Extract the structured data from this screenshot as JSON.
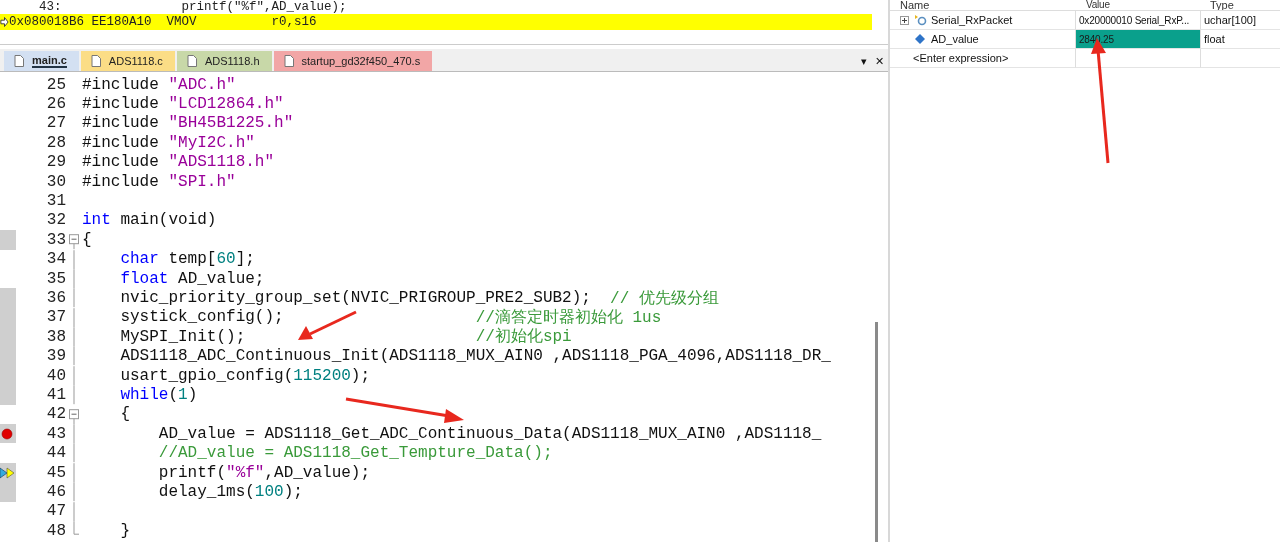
{
  "disassembly": {
    "lines": [
      {
        "text": "    43:                printf(\"%f\",AD_value);",
        "current": false
      },
      {
        "text": "0x080018B6 EE180A10  VMOV          r0,s16",
        "current": true
      }
    ]
  },
  "tabs": [
    {
      "label": "main.c",
      "selected": true,
      "color": "#d3e0f2"
    },
    {
      "label": "ADS1118.c",
      "selected": false,
      "color": "#fbdd86"
    },
    {
      "label": "ADS1118.h",
      "selected": false,
      "color": "#c8d8a8"
    },
    {
      "label": "startup_gd32f450_470.s",
      "selected": false,
      "color": "#f2a6a6"
    }
  ],
  "tab_bar": {
    "menu": "▾",
    "close": "✕"
  },
  "code": [
    {
      "number": "25",
      "executed": false,
      "breakpoint": false,
      "current": false,
      "fold_start": false,
      "in_fold": false,
      "tokens": [
        {
          "kind": "plain",
          "text": "#include "
        },
        {
          "kind": "string",
          "text": "\"ADC.h\""
        }
      ]
    },
    {
      "number": "26",
      "executed": false,
      "breakpoint": false,
      "current": false,
      "fold_start": false,
      "in_fold": false,
      "tokens": [
        {
          "kind": "plain",
          "text": "#include "
        },
        {
          "kind": "string",
          "text": "\"LCD12864.h\""
        }
      ]
    },
    {
      "number": "27",
      "executed": false,
      "breakpoint": false,
      "current": false,
      "fold_start": false,
      "in_fold": false,
      "tokens": [
        {
          "kind": "plain",
          "text": "#include "
        },
        {
          "kind": "string",
          "text": "\"BH45B1225.h\""
        }
      ]
    },
    {
      "number": "28",
      "executed": false,
      "breakpoint": false,
      "current": false,
      "fold_start": false,
      "in_fold": false,
      "tokens": [
        {
          "kind": "plain",
          "text": "#include "
        },
        {
          "kind": "string",
          "text": "\"MyI2C.h\""
        }
      ]
    },
    {
      "number": "29",
      "executed": false,
      "breakpoint": false,
      "current": false,
      "fold_start": false,
      "in_fold": false,
      "tokens": [
        {
          "kind": "plain",
          "text": "#include "
        },
        {
          "kind": "string",
          "text": "\"ADS1118.h\""
        }
      ]
    },
    {
      "number": "30",
      "executed": false,
      "breakpoint": false,
      "current": false,
      "fold_start": false,
      "in_fold": false,
      "tokens": [
        {
          "kind": "plain",
          "text": "#include "
        },
        {
          "kind": "string",
          "text": "\"SPI.h\""
        }
      ]
    },
    {
      "number": "31",
      "executed": false,
      "breakpoint": false,
      "current": false,
      "fold_start": false,
      "in_fold": false
    },
    {
      "number": "32",
      "executed": false,
      "breakpoint": false,
      "current": false,
      "fold_start": false,
      "in_fold": false,
      "tokens": [
        {
          "kind": "keyword",
          "text": "int"
        },
        {
          "kind": "plain",
          "text": " main(void)"
        }
      ]
    },
    {
      "number": "33",
      "executed": true,
      "breakpoint": false,
      "current": false,
      "fold_start": true,
      "in_fold": true,
      "tokens": [
        {
          "kind": "plain",
          "text": "{"
        }
      ]
    },
    {
      "number": "34",
      "executed": false,
      "breakpoint": false,
      "current": false,
      "fold_start": false,
      "in_fold": true,
      "tokens": [
        {
          "kind": "keyword",
          "text": "    char"
        },
        {
          "kind": "plain",
          "text": " temp["
        },
        {
          "kind": "number",
          "text": "60"
        },
        {
          "kind": "plain",
          "text": "];"
        }
      ]
    },
    {
      "number": "35",
      "executed": false,
      "breakpoint": false,
      "current": false,
      "fold_start": false,
      "in_fold": true,
      "tokens": [
        {
          "kind": "keyword",
          "text": "    float"
        },
        {
          "kind": "plain",
          "text": " AD_value;"
        }
      ]
    },
    {
      "number": "36",
      "executed": true,
      "breakpoint": false,
      "current": false,
      "fold_start": false,
      "in_fold": true,
      "tokens": [
        {
          "kind": "plain",
          "text": "    nvic_priority_group_set(NVIC_PRIGROUP_PRE2_SUB2);  "
        },
        {
          "kind": "comment",
          "text": "// 优先级分组"
        }
      ]
    },
    {
      "number": "37",
      "executed": true,
      "breakpoint": false,
      "current": false,
      "fold_start": false,
      "in_fold": true,
      "tokens": [
        {
          "kind": "plain",
          "text": "    systick_config();                    "
        },
        {
          "kind": "comment",
          "text": "//滴答定时器初始化 1us"
        }
      ]
    },
    {
      "number": "38",
      "executed": true,
      "breakpoint": false,
      "current": false,
      "fold_start": false,
      "in_fold": true,
      "tokens": [
        {
          "kind": "plain",
          "text": "    MySPI_Init();                        "
        },
        {
          "kind": "comment",
          "text": "//初始化spi"
        }
      ]
    },
    {
      "number": "39",
      "executed": true,
      "breakpoint": false,
      "current": false,
      "fold_start": false,
      "in_fold": true,
      "tokens": [
        {
          "kind": "plain",
          "text": "    ADS1118_ADC_Continuous_Init(ADS1118_MUX_AIN0 ,ADS1118_PGA_4096,ADS1118_DR_"
        }
      ]
    },
    {
      "number": "40",
      "executed": true,
      "breakpoint": false,
      "current": false,
      "fold_start": false,
      "in_fold": true,
      "tokens": [
        {
          "kind": "plain",
          "text": "    usart_gpio_config("
        },
        {
          "kind": "number",
          "text": "115200"
        },
        {
          "kind": "plain",
          "text": ");"
        }
      ]
    },
    {
      "number": "41",
      "executed": true,
      "breakpoint": false,
      "current": false,
      "fold_start": false,
      "in_fold": true,
      "tokens": [
        {
          "kind": "keyword",
          "text": "    while"
        },
        {
          "kind": "plain",
          "text": "("
        },
        {
          "kind": "number",
          "text": "1"
        },
        {
          "kind": "plain",
          "text": ")"
        }
      ]
    },
    {
      "number": "42",
      "executed": false,
      "breakpoint": false,
      "current": false,
      "fold_start": true,
      "in_fold": true,
      "tokens": [
        {
          "kind": "plain",
          "text": "    {"
        }
      ]
    },
    {
      "number": "43",
      "executed": true,
      "breakpoint": true,
      "current": false,
      "fold_start": false,
      "in_fold": true,
      "tokens": [
        {
          "kind": "plain",
          "text": "        AD_value = ADS1118_Get_ADC_Continuous_Data(ADS1118_MUX_AIN0 ,ADS1118_"
        }
      ]
    },
    {
      "number": "44",
      "executed": false,
      "breakpoint": false,
      "current": false,
      "fold_start": false,
      "in_fold": true,
      "tokens": [
        {
          "kind": "comment",
          "text": "        //AD_value = ADS1118_Get_Tempture_Data();"
        }
      ]
    },
    {
      "number": "45",
      "executed": true,
      "breakpoint": false,
      "current": true,
      "fold_start": false,
      "in_fold": true,
      "tokens": [
        {
          "kind": "plain",
          "text": "        printf("
        },
        {
          "kind": "string",
          "text": "\"%f\""
        },
        {
          "kind": "plain",
          "text": ",AD_value);"
        }
      ]
    },
    {
      "number": "46",
      "executed": true,
      "breakpoint": false,
      "current": false,
      "fold_start": false,
      "in_fold": true,
      "tokens": [
        {
          "kind": "plain",
          "text": "        delay_1ms("
        },
        {
          "kind": "number",
          "text": "100"
        },
        {
          "kind": "plain",
          "text": ");"
        }
      ]
    },
    {
      "number": "47",
      "executed": false,
      "breakpoint": false,
      "current": false,
      "fold_start": false,
      "in_fold": true
    },
    {
      "number": "48",
      "executed": false,
      "breakpoint": false,
      "current": false,
      "fold_start": false,
      "in_fold": true,
      "tokens": [
        {
          "kind": "plain",
          "text": "    }"
        }
      ]
    }
  ],
  "watch": {
    "columns": [
      "Name",
      "Value",
      "Type"
    ],
    "rows": [
      {
        "name": "Serial_RxPacket",
        "value": "0x20000010 Serial_RxP...",
        "type": "uchar[100]",
        "kind": "struct",
        "expanded": false,
        "changed": false
      },
      {
        "name": "AD_value",
        "value": "2840.25",
        "type": "float",
        "kind": "variable",
        "changed": true
      },
      {
        "name": "<Enter expression>",
        "kind": "input"
      }
    ]
  }
}
